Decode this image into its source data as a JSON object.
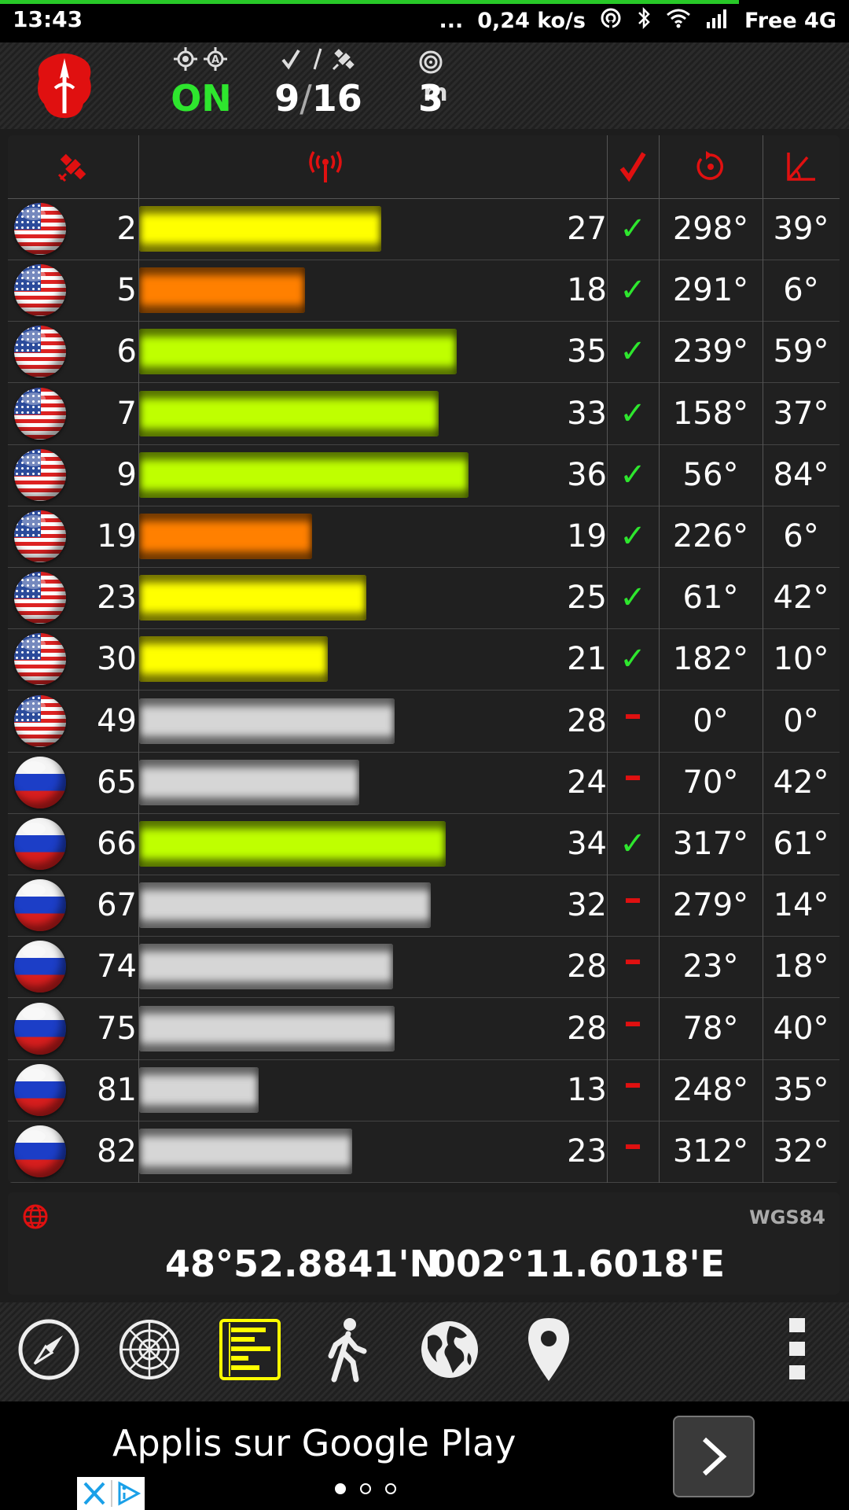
{
  "status": {
    "time": "13:43",
    "dots": "...",
    "speed": "0,24 ko/s",
    "carrier": "Free 4G"
  },
  "header": {
    "gps_state": "ON",
    "sats_used": "9",
    "sats_sep": "/",
    "sats_total": "16",
    "accuracy_unit": "m",
    "accuracy": "3"
  },
  "table": {
    "rows": [
      {
        "flag": "us",
        "prn": "2",
        "snr": "27",
        "used": true,
        "az": "298°",
        "el": "39°",
        "bar": 0.652,
        "color": "#ffff00"
      },
      {
        "flag": "us",
        "prn": "5",
        "snr": "18",
        "used": true,
        "az": "291°",
        "el": "6°",
        "bar": 0.447,
        "color": "#ff8000"
      },
      {
        "flag": "us",
        "prn": "6",
        "snr": "35",
        "used": true,
        "az": "239°",
        "el": "59°",
        "bar": 0.855,
        "color": "#bfff00"
      },
      {
        "flag": "us",
        "prn": "7",
        "snr": "33",
        "used": true,
        "az": "158°",
        "el": "37°",
        "bar": 0.805,
        "color": "#bfff00"
      },
      {
        "flag": "us",
        "prn": "9",
        "snr": "36",
        "used": true,
        "az": "56°",
        "el": "84°",
        "bar": 0.885,
        "color": "#bfff00"
      },
      {
        "flag": "us",
        "prn": "19",
        "snr": "19",
        "used": true,
        "az": "226°",
        "el": "6°",
        "bar": 0.465,
        "color": "#ff8000"
      },
      {
        "flag": "us",
        "prn": "23",
        "snr": "25",
        "used": true,
        "az": "61°",
        "el": "42°",
        "bar": 0.612,
        "color": "#ffff00"
      },
      {
        "flag": "us",
        "prn": "30",
        "snr": "21",
        "used": true,
        "az": "182°",
        "el": "10°",
        "bar": 0.508,
        "color": "#ffff00"
      },
      {
        "flag": "us",
        "prn": "49",
        "snr": "28",
        "used": false,
        "az": "0°",
        "el": "0°",
        "bar": 0.688,
        "color": "#d6d6d6"
      },
      {
        "flag": "ru",
        "prn": "65",
        "snr": "24",
        "used": false,
        "az": "70°",
        "el": "42°",
        "bar": 0.592,
        "color": "#d6d6d6"
      },
      {
        "flag": "ru",
        "prn": "66",
        "snr": "34",
        "used": true,
        "az": "317°",
        "el": "61°",
        "bar": 0.825,
        "color": "#bfff00"
      },
      {
        "flag": "ru",
        "prn": "67",
        "snr": "32",
        "used": false,
        "az": "279°",
        "el": "14°",
        "bar": 0.785,
        "color": "#d6d6d6"
      },
      {
        "flag": "ru",
        "prn": "74",
        "snr": "28",
        "used": false,
        "az": "23°",
        "el": "18°",
        "bar": 0.682,
        "color": "#d6d6d6"
      },
      {
        "flag": "ru",
        "prn": "75",
        "snr": "28",
        "used": false,
        "az": "78°",
        "el": "40°",
        "bar": 0.688,
        "color": "#d6d6d6"
      },
      {
        "flag": "ru",
        "prn": "81",
        "snr": "13",
        "used": false,
        "az": "248°",
        "el": "35°",
        "bar": 0.322,
        "color": "#d6d6d6"
      },
      {
        "flag": "ru",
        "prn": "82",
        "snr": "23",
        "used": false,
        "az": "312°",
        "el": "32°",
        "bar": 0.572,
        "color": "#d6d6d6"
      }
    ],
    "used_glyph": "✓",
    "unused_glyph": "–"
  },
  "coords": {
    "datum": "WGS84",
    "lat": "48°52.8841'N",
    "lon": "002°11.6018'E"
  },
  "toolbar": {
    "items": [
      "compass-icon",
      "radar-icon",
      "signal-bars-icon",
      "walking-person-icon",
      "globe-icon",
      "map-pin-icon",
      "overflow-menu-icon"
    ],
    "active": "signal-bars-icon",
    "active_color": "#ffff00"
  },
  "ad": {
    "text": "Applis sur Google Play"
  },
  "colors": {
    "accent_red": "#e01010",
    "gps_on_green": "#2ee62e"
  }
}
